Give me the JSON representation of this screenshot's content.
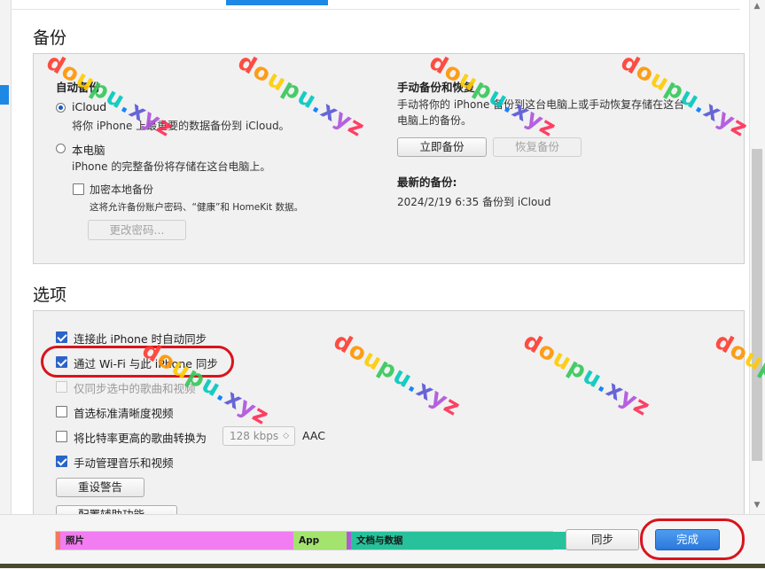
{
  "backup": {
    "title": "备份",
    "auto_backup_label": "自动备份",
    "icloud_label": "iCloud",
    "icloud_desc": "将你 iPhone 上最重要的数据备份到 iCloud。",
    "computer_label": "本电脑",
    "computer_desc": "iPhone 的完整备份将存储在这台电脑上。",
    "encrypt_label": "加密本地备份",
    "encrypt_desc": "这将允许备份账户密码、“健康”和 HomeKit 数据。",
    "change_password_button": "更改密码...",
    "manual_title": "手动备份和恢复",
    "manual_desc_line1": "手动将你的 iPhone 备份到这台电脑上或手动恢复存储在这台",
    "manual_desc_line2": "电脑上的备份。",
    "backup_now_button": "立即备份",
    "restore_button": "恢复备份",
    "latest_title": "最新的备份:",
    "latest_value": "2024/2/19 6:35 备份到 iCloud"
  },
  "options": {
    "title": "选项",
    "items": [
      {
        "label": "连接此 iPhone 时自动同步",
        "checked": true,
        "enabled": true
      },
      {
        "label": "通过 Wi-Fi 与此 iPhone 同步",
        "checked": true,
        "enabled": true
      },
      {
        "label": "仅同步选中的歌曲和视频",
        "checked": false,
        "enabled": false
      },
      {
        "label": "首选标准清晰度视频",
        "checked": false,
        "enabled": true
      },
      {
        "label": "将比特率更高的歌曲转换为",
        "checked": false,
        "enabled": true
      },
      {
        "label": "手动管理音乐和视频",
        "checked": true,
        "enabled": true
      }
    ],
    "bitrate_value": "128 kbps",
    "bitrate_suffix": "AAC",
    "reset_warnings_button": "重设警告",
    "accessibility_button": "配置辅助功能..."
  },
  "capacity": {
    "segments": [
      {
        "label": "",
        "color": "#f07a5a"
      },
      {
        "label": "照片",
        "color": "#f27cf2"
      },
      {
        "label": "App",
        "color": "#a3e46f"
      },
      {
        "label": "",
        "color": "#b05ad6"
      },
      {
        "label": "文档与数据",
        "color": "#27c29b"
      },
      {
        "label": "",
        "color": "#d6d6d6"
      }
    ]
  },
  "footer": {
    "sync_button": "同步",
    "done_button": "完成"
  },
  "watermark": "doupu.xyz",
  "colors": {
    "accent": "#2b63c8",
    "highlight_oval": "#d8141c"
  }
}
